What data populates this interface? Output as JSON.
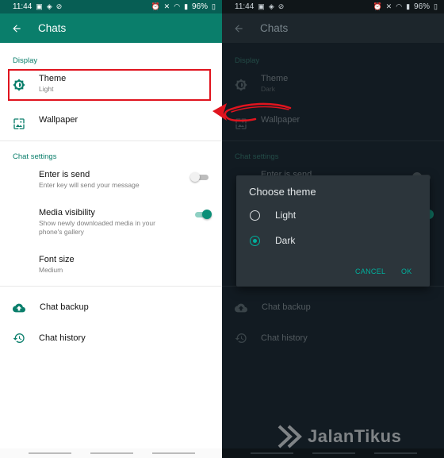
{
  "status_left": {
    "time": "11:44"
  },
  "status_right": {
    "time": "11:44"
  },
  "battery": "96%",
  "app_bar": {
    "title": "Chats"
  },
  "sections": {
    "display": "Display",
    "chat_settings": "Chat settings"
  },
  "items": {
    "theme": {
      "label": "Theme",
      "value_light": "Light",
      "value_dark": "Dark"
    },
    "wallpaper": {
      "label": "Wallpaper"
    },
    "enter_is_send": {
      "label": "Enter is send",
      "description": "Enter key will send your message",
      "enabled": false
    },
    "media_visibility": {
      "label": "Media visibility",
      "description_line1": "Show newly downloaded media in your",
      "description_line2": "phone's gallery",
      "enabled": true
    },
    "font_size": {
      "label": "Font size",
      "value": "Medium"
    },
    "chat_backup": {
      "label": "Chat backup"
    },
    "chat_history": {
      "label": "Chat history"
    }
  },
  "dialog": {
    "title": "Choose theme",
    "options": [
      {
        "label": "Light",
        "selected": false
      },
      {
        "label": "Dark",
        "selected": true
      }
    ],
    "cancel": "CANCEL",
    "ok": "OK"
  },
  "watermark": "JalanTikus",
  "colors": {
    "brand_dark": "#075e54",
    "brand": "#0a7e6b",
    "accent": "#00af9c",
    "highlight": "#e0141e",
    "dark_bg": "#121b22"
  },
  "icons": {
    "back": "arrow-left-icon",
    "theme": "brightness-icon",
    "wallpaper": "wallpaper-icon",
    "backup": "cloud-upload-icon",
    "history": "history-icon"
  }
}
